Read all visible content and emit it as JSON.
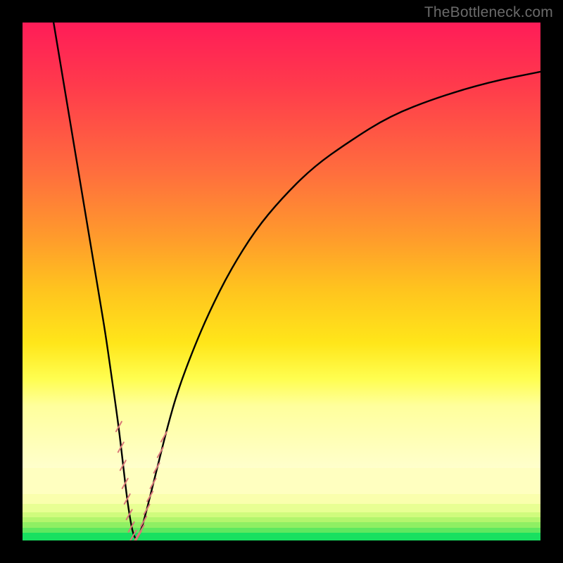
{
  "watermark": "TheBottleneck.com",
  "colors": {
    "frame": "#000000",
    "curve": "#000000",
    "marker": "#d87878",
    "gradient_top": "#ff1c58",
    "gradient_bottom_green": "#18e060"
  },
  "chart_data": {
    "type": "line",
    "title": "",
    "xlabel": "",
    "ylabel": "",
    "xlim": [
      0,
      100
    ],
    "ylim": [
      0,
      100
    ],
    "series": [
      {
        "name": "bottleneck-curve",
        "x": [
          6,
          8,
          10,
          12,
          14,
          15,
          16,
          17,
          18,
          18.8,
          19.6,
          20.2,
          20.8,
          21.3,
          21.8,
          22.3,
          23,
          24,
          25,
          26,
          28,
          30,
          33,
          36,
          40,
          45,
          50,
          56,
          63,
          71,
          80,
          90,
          100
        ],
        "y": [
          100,
          88,
          76,
          64,
          52,
          46,
          40,
          33,
          26,
          20,
          13,
          8,
          4,
          1.5,
          0.3,
          0.6,
          2.3,
          6,
          10,
          14,
          22,
          29,
          37,
          44,
          52,
          60,
          66,
          72,
          77,
          82,
          85.5,
          88.5,
          90.5
        ]
      }
    ],
    "markers": {
      "name": "data-points",
      "points": [
        {
          "x": 18.6,
          "y": 22
        },
        {
          "x": 19.0,
          "y": 18
        },
        {
          "x": 19.4,
          "y": 14.5
        },
        {
          "x": 19.8,
          "y": 11
        },
        {
          "x": 20.2,
          "y": 8
        },
        {
          "x": 20.6,
          "y": 5
        },
        {
          "x": 21.0,
          "y": 2.6
        },
        {
          "x": 21.4,
          "y": 1.0
        },
        {
          "x": 21.9,
          "y": 0.4
        },
        {
          "x": 22.4,
          "y": 0.9
        },
        {
          "x": 22.9,
          "y": 2.0
        },
        {
          "x": 23.4,
          "y": 3.7
        },
        {
          "x": 24.0,
          "y": 6.0
        },
        {
          "x": 24.6,
          "y": 8.5
        },
        {
          "x": 25.2,
          "y": 11
        },
        {
          "x": 25.9,
          "y": 14
        },
        {
          "x": 26.6,
          "y": 17
        },
        {
          "x": 27.3,
          "y": 20
        }
      ]
    },
    "gradient_bands": [
      {
        "from": 100,
        "to": 14,
        "kind": "smooth-red-to-yellow"
      },
      {
        "from": 14,
        "to": 9,
        "color": "#ffffc0"
      },
      {
        "from": 9,
        "to": 7,
        "color": "#faffad"
      },
      {
        "from": 7,
        "to": 5.5,
        "color": "#e8ff93"
      },
      {
        "from": 5.5,
        "to": 4.5,
        "color": "#d0fb7d"
      },
      {
        "from": 4.5,
        "to": 3.5,
        "color": "#b3f56d"
      },
      {
        "from": 3.5,
        "to": 2.5,
        "color": "#8fef63"
      },
      {
        "from": 2.5,
        "to": 1.5,
        "color": "#5fe85f"
      },
      {
        "from": 1.5,
        "to": 0,
        "color": "#18e060"
      }
    ]
  }
}
